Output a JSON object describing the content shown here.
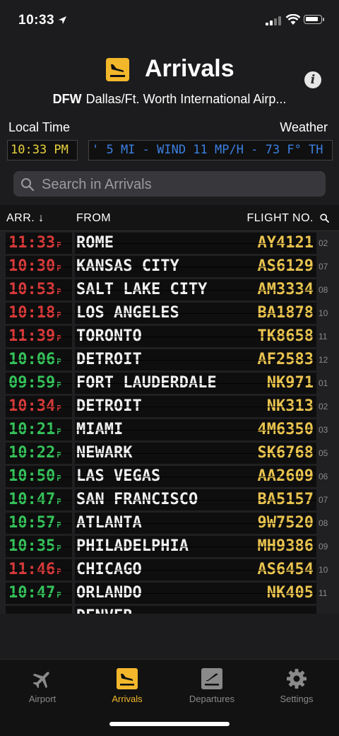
{
  "status": {
    "time": "10:33"
  },
  "header": {
    "title": "Arrivals",
    "airport_code": "DFW",
    "airport_name": "Dallas/Ft. Worth International Airp..."
  },
  "info": {
    "local_time_label": "Local Time",
    "weather_label": "Weather"
  },
  "led": {
    "time": "10:33 PM",
    "weather": "' 5 MI - WIND 11 MP/H - 73 F° TH"
  },
  "search": {
    "placeholder": "Search in Arrivals"
  },
  "table": {
    "col_arr": "ARR. ↓",
    "col_from": "FROM",
    "col_flight": "FLIGHT NO."
  },
  "flights": [
    {
      "time": "11:33",
      "ampm": "P",
      "status": "late",
      "city": "ROME",
      "flight": "AY4121",
      "gate": "02"
    },
    {
      "time": "10:30",
      "ampm": "P",
      "status": "late",
      "city": "KANSAS CITY",
      "flight": "AS6129",
      "gate": "07"
    },
    {
      "time": "10:53",
      "ampm": "P",
      "status": "late",
      "city": "SALT LAKE CITY",
      "flight": "AM3334",
      "gate": "08"
    },
    {
      "time": "10:18",
      "ampm": "P",
      "status": "late",
      "city": "LOS ANGELES",
      "flight": "BA1878",
      "gate": "10"
    },
    {
      "time": "11:39",
      "ampm": "P",
      "status": "late",
      "city": "TORONTO",
      "flight": "TK8658",
      "gate": "11"
    },
    {
      "time": "10:06",
      "ampm": "P",
      "status": "ontime",
      "city": "DETROIT",
      "flight": "AF2583",
      "gate": "12"
    },
    {
      "time": "09:59",
      "ampm": "P",
      "status": "ontime",
      "city": "FORT LAUDERDALE",
      "flight": "NK971",
      "gate": "01"
    },
    {
      "time": "10:34",
      "ampm": "P",
      "status": "late",
      "city": "DETROIT",
      "flight": "NK313",
      "gate": "02"
    },
    {
      "time": "10:21",
      "ampm": "P",
      "status": "ontime",
      "city": "MIAMI",
      "flight": "4M6350",
      "gate": "03"
    },
    {
      "time": "10:22",
      "ampm": "P",
      "status": "ontime",
      "city": "NEWARK",
      "flight": "SK6768",
      "gate": "05"
    },
    {
      "time": "10:50",
      "ampm": "P",
      "status": "ontime",
      "city": "LAS VEGAS",
      "flight": "AA2609",
      "gate": "06"
    },
    {
      "time": "10:47",
      "ampm": "P",
      "status": "ontime",
      "city": "SAN FRANCISCO",
      "flight": "BA5157",
      "gate": "07"
    },
    {
      "time": "10:57",
      "ampm": "P",
      "status": "ontime",
      "city": "ATLANTA",
      "flight": "9W7520",
      "gate": "08"
    },
    {
      "time": "10:35",
      "ampm": "P",
      "status": "ontime",
      "city": "PHILADELPHIA",
      "flight": "MH9386",
      "gate": "09"
    },
    {
      "time": "11:46",
      "ampm": "P",
      "status": "late",
      "city": "CHICAGO",
      "flight": "AS6454",
      "gate": "10"
    },
    {
      "time": "10:47",
      "ampm": "P",
      "status": "ontime",
      "city": "ORLANDO",
      "flight": "NK405",
      "gate": "11"
    },
    {
      "time": "",
      "ampm": "",
      "status": "ontime",
      "city": "DENVER",
      "flight": "",
      "gate": ""
    }
  ],
  "colors": {
    "accent": "#f2b72b",
    "late": "#d83a3a",
    "ontime": "#35c25a",
    "flight_no": "#e9c34f",
    "weather_led": "#3b7fe0"
  },
  "tabs": [
    {
      "label": "Airport",
      "icon": "airplane-icon",
      "active": false
    },
    {
      "label": "Arrivals",
      "icon": "arrivals-icon",
      "active": true
    },
    {
      "label": "Departures",
      "icon": "departures-icon",
      "active": false
    },
    {
      "label": "Settings",
      "icon": "gear-icon",
      "active": false
    }
  ]
}
